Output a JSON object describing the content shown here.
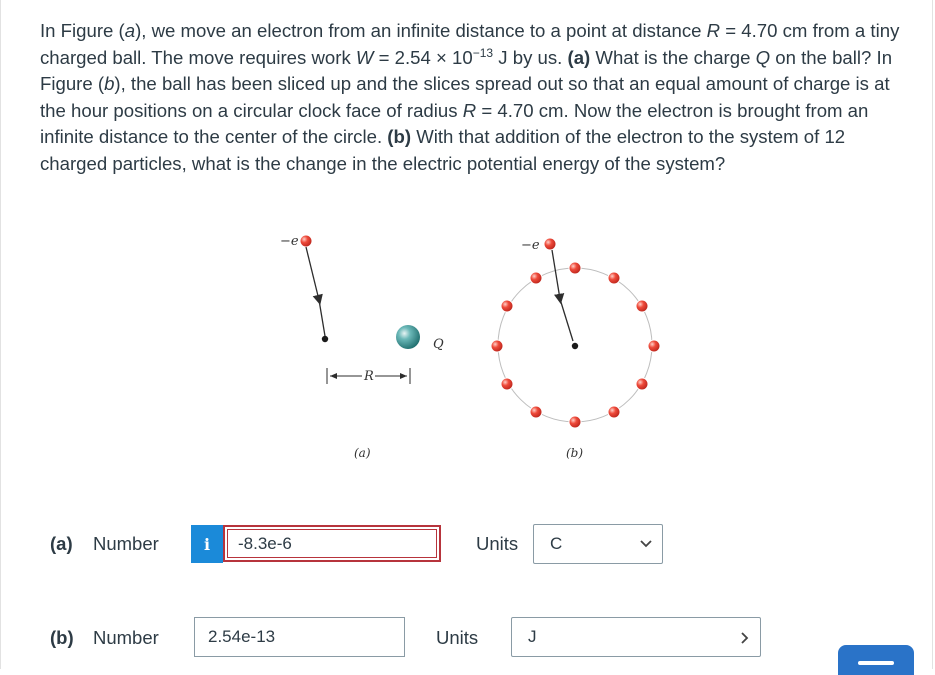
{
  "question": {
    "part1": "In Figure (",
    "a_italic": "a",
    "part2": "), we move an electron from an infinite distance to a point at distance ",
    "R1": "R",
    "part3": " = 4.70 cm from a tiny charged ball. The move requires work ",
    "W": "W",
    "part4": " = 2.54 × 10",
    "exp": "−13",
    "part5": " J by us. ",
    "qa_bold": "(a)",
    "part6": " What is the charge ",
    "Q": "Q",
    "part7": " on the ball? In Figure (",
    "b_italic": "b",
    "part8": "), the ball has been sliced up and the slices spread out so that an equal amount of charge is at the hour positions on a circular clock face of radius ",
    "R2": "R",
    "part9": " = 4.70 cm. Now the electron is brought from an infinite distance to the center of the circle. ",
    "qb_bold": "(b)",
    "part10": " With that addition of the electron to the system of 12 charged particles, what is the change in the electric potential energy of the system?"
  },
  "figure": {
    "electron_label_a": "−e",
    "electron_label_b": "−e",
    "charge_label": "Q",
    "distance_label": "R",
    "caption_a": "(a)",
    "caption_b": "(b)"
  },
  "answer_a": {
    "part_label": "(a)",
    "number_label": "Number",
    "info_icon": "i",
    "value": "-8.3e-6",
    "units_label": "Units",
    "unit_value": "C"
  },
  "answer_b": {
    "part_label": "(b)",
    "number_label": "Number",
    "value": "2.54e-13",
    "units_label": "Units",
    "unit_value": "J"
  },
  "colors": {
    "info_blue": "#1b8ad9",
    "error_red": "#b7343c",
    "charge_red": "#e63a2e",
    "ball_teal": "#3e9a9a",
    "tab_blue": "#2a73c8"
  }
}
